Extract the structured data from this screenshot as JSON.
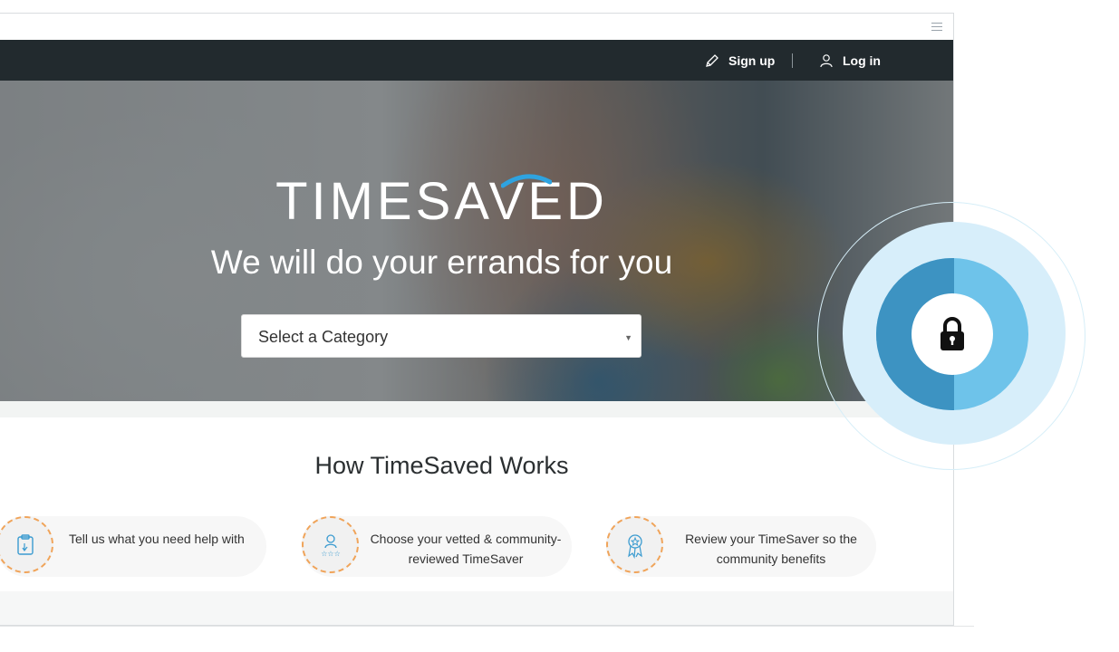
{
  "nav": {
    "signup_label": "Sign up",
    "login_label": "Log in"
  },
  "hero": {
    "logo_text": "TIMESAVED",
    "tagline": "We will do your errands for you",
    "category_select": {
      "selected": "Select a Category"
    }
  },
  "how_it_works": {
    "title": "How TimeSaved Works",
    "steps": [
      {
        "icon": "clipboard-icon",
        "text": "Tell us what you need help with"
      },
      {
        "icon": "rated-person-icon",
        "text": "Choose your vetted & community-reviewed TimeSaver"
      },
      {
        "icon": "award-ribbon-icon",
        "text": "Review your TimeSaver so the community benefits"
      }
    ]
  },
  "security_badge": {
    "icon": "lock-icon"
  },
  "colors": {
    "navbar": "#222a2e",
    "accent_blue": "#3d93c2",
    "light_blue": "#6ec3ea",
    "step_border": "#f0a45a"
  }
}
